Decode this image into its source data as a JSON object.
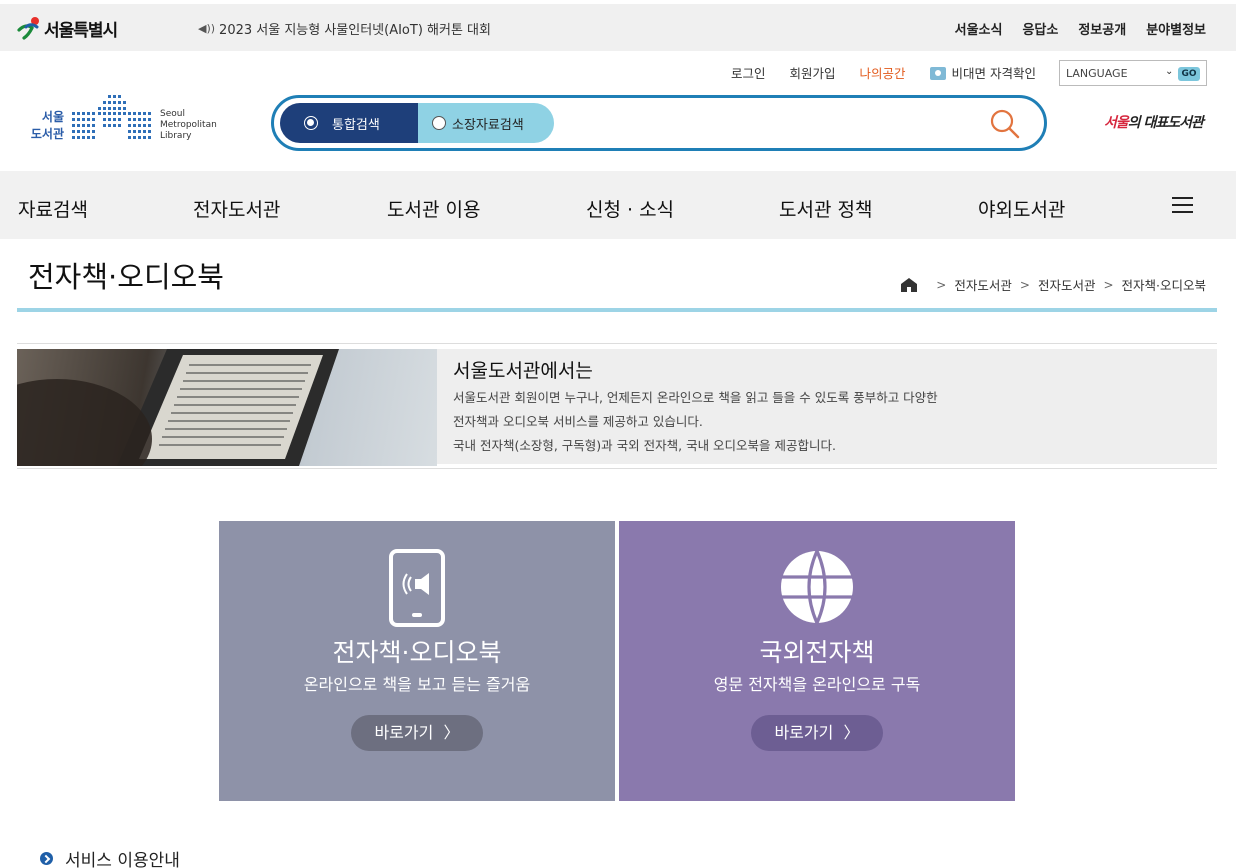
{
  "gov_bar": {
    "logo_text": "서울특별시",
    "notice": "2023 서울 지능형 사물인터넷(AIoT) 해커톤 대회",
    "links": [
      "서울소식",
      "응답소",
      "정보공개",
      "분야별정보"
    ]
  },
  "util": {
    "login": "로그인",
    "join": "회원가입",
    "my_space": "나의공간",
    "verify": "비대면 자격확인",
    "language_label": "LANGUAGE",
    "go_label": "GO"
  },
  "library_logo": {
    "ko_line1": "서울",
    "ko_line2": "도서관",
    "en_line1": "Seoul",
    "en_line2": "Metropolitan",
    "en_line3": "Library"
  },
  "search": {
    "tab_all": "통합검색",
    "tab_holdings": "소장자료검색",
    "selected": "통합검색"
  },
  "seoul_mark": {
    "text_a": "서울",
    "text_b": "의 대표도서관"
  },
  "gnb": [
    "자료검색",
    "전자도서관",
    "도서관 이용",
    "신청 · 소식",
    "도서관 정책",
    "야외도서관"
  ],
  "page": {
    "title": "전자책·오디오북",
    "breadcrumb": [
      "전자도서관",
      "전자도서관",
      "전자책·오디오북"
    ]
  },
  "intro": {
    "title": "서울도서관에서는",
    "line1": "서울도서관 회원이면 누구나, 언제든지 온라인으로 책을 읽고 들을 수 있도록 풍부하고 다양한",
    "line2": "전자책과 오디오북 서비스를 제공하고 있습니다.",
    "line3": "국내 전자책(소장형, 구독형)과 국외 전자책, 국내 오디오북을 제공합니다."
  },
  "cards": [
    {
      "title": "전자책·오디오북",
      "subtitle": "온라인으로 책을 보고 듣는 즐거움",
      "button": "바로가기",
      "icon": "tablet-audio-icon",
      "color": "#8e92a8"
    },
    {
      "title": "국외전자책",
      "subtitle": "영문 전자책을 온라인으로 구독",
      "button": "바로가기",
      "icon": "globe-icon",
      "color": "#8a79ad"
    }
  ],
  "service_guide": "서비스 이용안내",
  "colors": {
    "accent": "#1f7fb6",
    "navy": "#1e3f7a",
    "highlight": "#e25a1c"
  }
}
